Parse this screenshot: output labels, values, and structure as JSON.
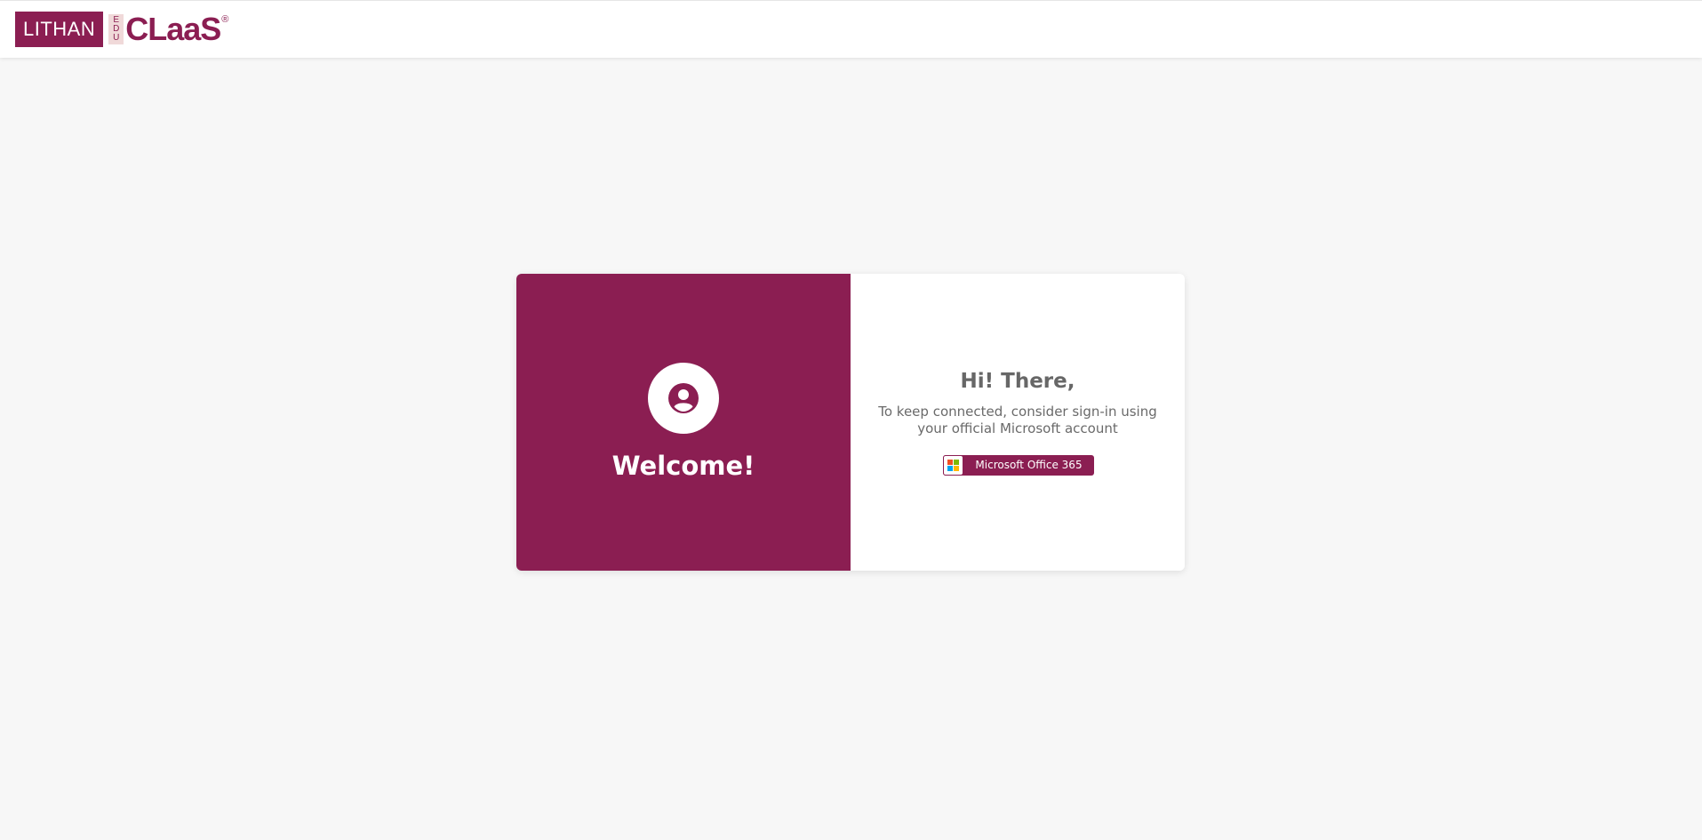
{
  "header": {
    "logo": {
      "lithan": "LITHAN",
      "edu": [
        "E",
        "D",
        "U"
      ],
      "claas": "CLaaS",
      "registered": "®"
    }
  },
  "login_card": {
    "left_panel": {
      "avatar_icon": "user-circle-icon",
      "welcome": "Welcome!"
    },
    "right_panel": {
      "greeting": "Hi! There,",
      "subtext": "To keep connected, consider sign-in using your official Microsoft account",
      "signin_button": {
        "icon": "microsoft-logo-icon",
        "label": "Microsoft Office 365"
      }
    }
  },
  "colors": {
    "brand": "#8b1e52",
    "background": "#f7f7f7",
    "text_muted": "#676767"
  }
}
